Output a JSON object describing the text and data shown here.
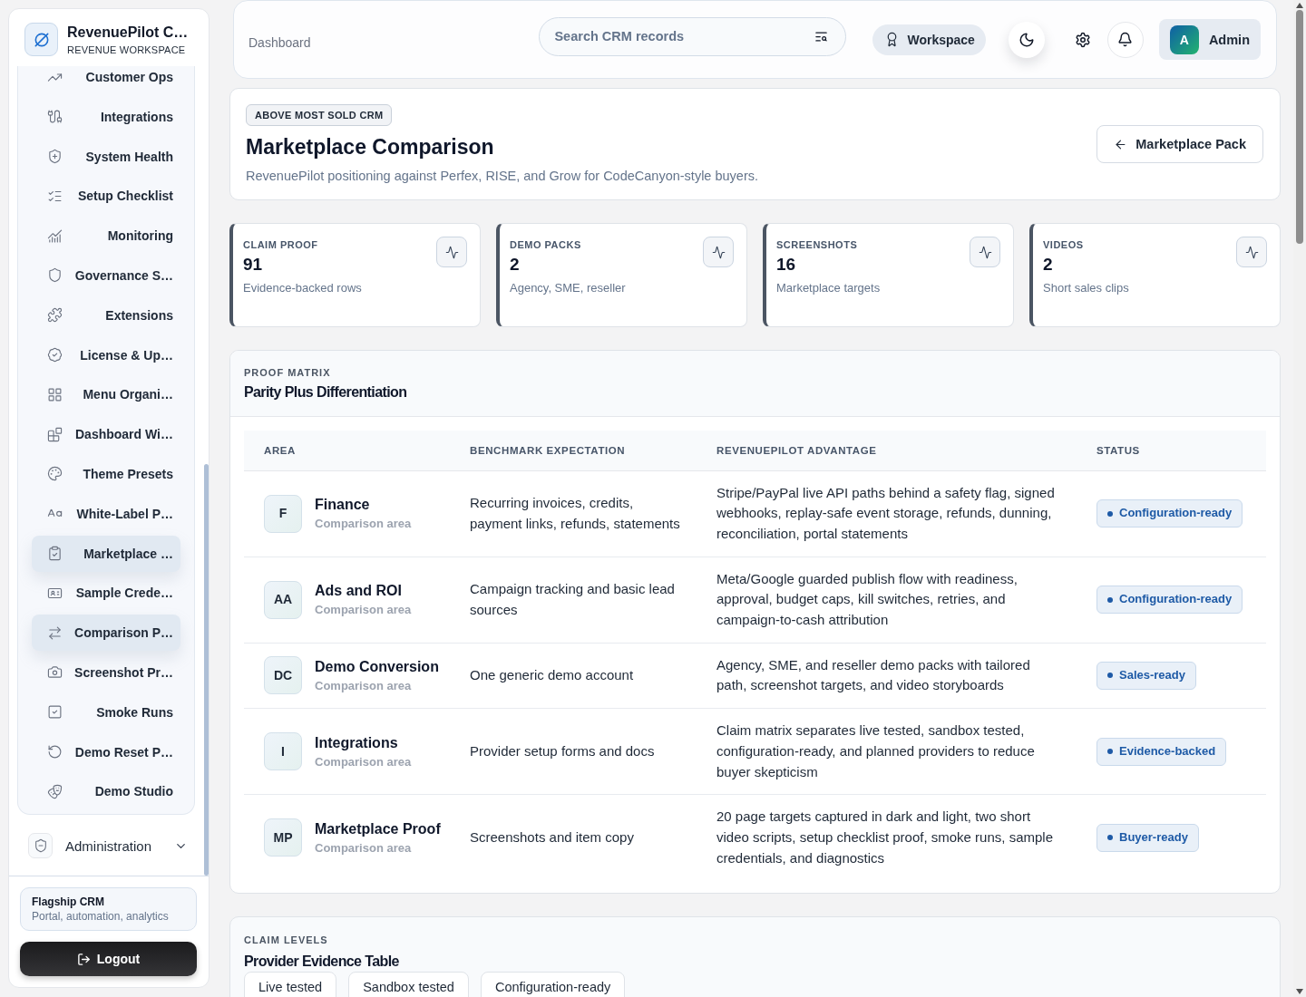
{
  "sidebar": {
    "brand": {
      "title": "RevenuePilot C…",
      "subtitle": "REVENUE WORKSPACE"
    },
    "nav_items": [
      {
        "label": "Customer Ops",
        "selected": false
      },
      {
        "label": "Integrations",
        "selected": false
      },
      {
        "label": "System Health",
        "selected": false
      },
      {
        "label": "Setup Checklist",
        "selected": false
      },
      {
        "label": "Monitoring",
        "selected": false
      },
      {
        "label": "Governance S…",
        "selected": false
      },
      {
        "label": "Extensions",
        "selected": false
      },
      {
        "label": "License & Up…",
        "selected": false
      },
      {
        "label": "Menu Organi…",
        "selected": false
      },
      {
        "label": "Dashboard Wi…",
        "selected": false
      },
      {
        "label": "Theme Presets",
        "selected": false
      },
      {
        "label": "White-Label P…",
        "selected": false
      },
      {
        "label": "Marketplace …",
        "selected": true
      },
      {
        "label": "Sample Crede…",
        "selected": false
      },
      {
        "label": "Comparison P…",
        "selected": true
      },
      {
        "label": "Screenshot Pr…",
        "selected": false
      },
      {
        "label": "Smoke Runs",
        "selected": false
      },
      {
        "label": "Demo Reset P…",
        "selected": false
      },
      {
        "label": "Demo Studio",
        "selected": false
      }
    ],
    "group": {
      "label": "Administration",
      "expanded": false
    },
    "promo": {
      "title": "Flagship CRM",
      "text": "Portal, automation, analytics"
    },
    "logout": {
      "label": "Logout"
    }
  },
  "header": {
    "breadcrumb": "Dashboard",
    "search": {
      "placeholder": "Search CRM records"
    },
    "workspace": "Workspace",
    "user": {
      "initial": "A",
      "name": "Admin"
    }
  },
  "page": {
    "badge": "ABOVE MOST SOLD CRM",
    "title": "Marketplace Comparison",
    "subtitle": "RevenuePilot positioning against Perfex, RISE, and Grow for CodeCanyon-style buyers.",
    "action": "Marketplace Pack"
  },
  "stats": [
    {
      "label": "CLAIM PROOF",
      "value": "91",
      "text": "Evidence-backed rows"
    },
    {
      "label": "DEMO PACKS",
      "value": "2",
      "text": "Agency, SME, reseller"
    },
    {
      "label": "SCREENSHOTS",
      "value": "16",
      "text": "Marketplace targets"
    },
    {
      "label": "VIDEOS",
      "value": "2",
      "text": "Short sales clips"
    }
  ],
  "proof_matrix": {
    "eyebrow": "PROOF MATRIX",
    "title": "Parity Plus Differentiation",
    "columns": [
      "AREA",
      "BENCHMARK EXPECTATION",
      "REVENUEPILOT ADVANTAGE",
      "STATUS"
    ],
    "rows": [
      {
        "initials": "F",
        "area": "Finance",
        "note": "Comparison area",
        "benchmark": "Recurring invoices, credits, payment links, refunds, statements",
        "advantage": "Stripe/PayPal live API paths behind a safety flag, signed webhooks, replay-safe event storage, refunds, dunning, reconciliation, portal statements",
        "status": "Configuration-ready"
      },
      {
        "initials": "AA",
        "area": "Ads and ROI",
        "note": "Comparison area",
        "benchmark": "Campaign tracking and basic lead sources",
        "advantage": "Meta/Google guarded publish flow with readiness, approval, budget caps, kill switches, retries, and campaign-to-cash attribution",
        "status": "Configuration-ready"
      },
      {
        "initials": "DC",
        "area": "Demo Conversion",
        "note": "Comparison area",
        "benchmark": "One generic demo account",
        "advantage": "Agency, SME, and reseller demo packs with tailored path, screenshot targets, and video storyboards",
        "status": "Sales-ready"
      },
      {
        "initials": "I",
        "area": "Integrations",
        "note": "Comparison area",
        "benchmark": "Provider setup forms and docs",
        "advantage": "Claim matrix separates live tested, sandbox tested, configuration-ready, and planned providers to reduce buyer skepticism",
        "status": "Evidence-backed"
      },
      {
        "initials": "MP",
        "area": "Marketplace Proof",
        "note": "Comparison area",
        "benchmark": "Screenshots and item copy",
        "advantage": "20 page targets captured in dark and light, two short video scripts, setup checklist proof, smoke runs, sample credentials, and diagnostics",
        "status": "Buyer-ready"
      }
    ]
  },
  "claim_levels": {
    "eyebrow": "CLAIM LEVELS",
    "title": "Provider Evidence Table",
    "levels": [
      "Live tested",
      "Sandbox tested",
      "Configuration-ready"
    ]
  }
}
